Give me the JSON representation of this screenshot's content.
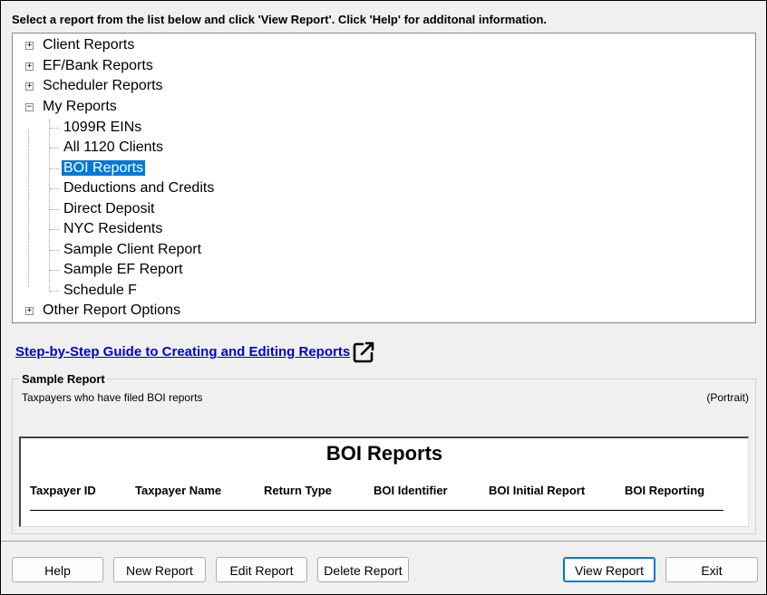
{
  "instruction": "Select a report from the list below and click 'View Report'.  Click 'Help' for additonal information.",
  "tree": {
    "top": [
      {
        "label": "Client Reports",
        "expander": "+"
      },
      {
        "label": "EF/Bank Reports",
        "expander": "+"
      },
      {
        "label": "Scheduler Reports",
        "expander": "+"
      },
      {
        "label": "My Reports",
        "expander": "−"
      }
    ],
    "my_reports": [
      "1099R EINs",
      "All 1120 Clients",
      "BOI Reports",
      "Deductions and Credits",
      "Direct Deposit",
      "NYC Residents",
      "Sample Client Report",
      "Sample EF Report",
      "Schedule F"
    ],
    "selected": "BOI Reports",
    "last": {
      "label": "Other Report Options",
      "expander": "+"
    }
  },
  "guide_link": "Step-by-Step Guide to Creating and Editing Reports",
  "sample": {
    "group_title": "Sample Report",
    "description": "Taxpayers who have filed BOI reports",
    "orientation": "(Portrait)",
    "preview_title": "BOI Reports",
    "columns": [
      "Taxpayer ID",
      "Taxpayer Name",
      "Return Type",
      "BOI Identifier",
      "BOI Initial Report",
      "BOI Reporting"
    ]
  },
  "buttons": {
    "help": "Help",
    "new_report": "New Report",
    "edit_report": "Edit Report",
    "delete_report": "Delete Report",
    "view_report": "View Report",
    "exit": "Exit"
  }
}
